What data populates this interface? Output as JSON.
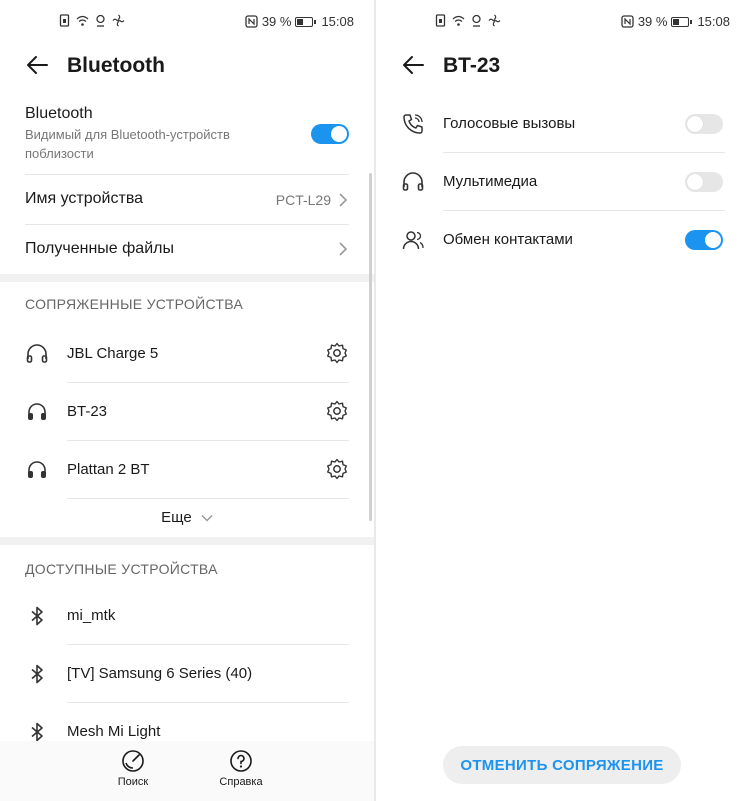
{
  "accent_color": "#1b94f0",
  "status_bar": {
    "battery": "39 %",
    "time": "15:08"
  },
  "left_screen": {
    "title": "Bluetooth",
    "bluetooth": {
      "label": "Bluetooth",
      "subtitle": "Видимый для Bluetooth-устройств поблизости",
      "enabled": true
    },
    "device_name": {
      "label": "Имя устройства",
      "value": "PCT-L29"
    },
    "received_files": {
      "label": "Полученные файлы"
    },
    "paired_section": {
      "title": "СОПРЯЖЕННЫЕ УСТРОЙСТВА",
      "devices": [
        {
          "name": "JBL Charge 5",
          "icon": "headphones-icon"
        },
        {
          "name": "BT-23",
          "icon": "headset-icon"
        },
        {
          "name": "Plattan 2 BT",
          "icon": "headset-icon"
        }
      ],
      "more_label": "Еще"
    },
    "available_section": {
      "title": "ДОСТУПНЫЕ УСТРОЙСТВА",
      "devices": [
        {
          "name": "mi_mtk",
          "icon": "bluetooth-icon"
        },
        {
          "name": "[TV] Samsung 6 Series (40)",
          "icon": "bluetooth-icon"
        },
        {
          "name": "Mesh Mi Light",
          "icon": "bluetooth-icon"
        }
      ]
    },
    "bottom_nav": {
      "search_label": "Поиск",
      "help_label": "Справка"
    }
  },
  "right_screen": {
    "title": "BT-23",
    "profiles": [
      {
        "label": "Голосовые вызовы",
        "icon": "phone-icon",
        "enabled": false
      },
      {
        "label": "Мультимедиа",
        "icon": "headphones-icon",
        "enabled": false
      },
      {
        "label": "Обмен контактами",
        "icon": "contacts-icon",
        "enabled": true
      }
    ],
    "unpair_label": "ОТМЕНИТЬ СОПРЯЖЕНИЕ"
  }
}
